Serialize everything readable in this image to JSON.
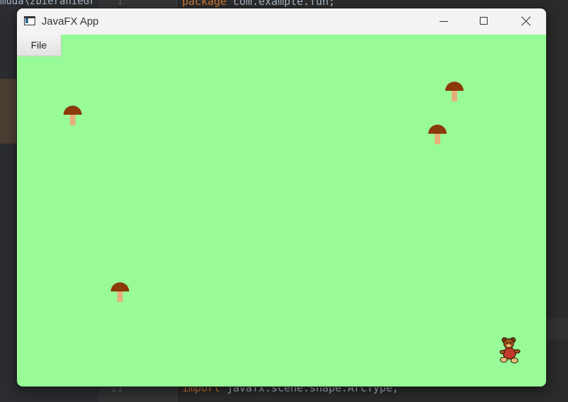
{
  "ide": {
    "project_path_fragment": "muda\\zbieranieGr",
    "line_top": "1",
    "line_bottom": "21",
    "code_top_keyword": "package",
    "code_top_rest": " com.example.fun;",
    "code_bottom_keyword": "import",
    "code_bottom_rest": " javafx.scene.shape.ArcType;"
  },
  "window": {
    "title": "JavaFX App",
    "icon": "java-app-icon",
    "controls": {
      "minimize_icon": "minimize-icon",
      "maximize_icon": "maximize-icon",
      "close_icon": "close-icon"
    }
  },
  "menu": {
    "items": [
      {
        "label": "File"
      }
    ]
  },
  "scene": {
    "background_color": "#99fb97",
    "mushroom_cap_color": "#8b3a0b",
    "mushroom_stem_color": "#e6b07a",
    "mushroom_count": 4,
    "player_sprite": "teddy-bear-sprite"
  }
}
